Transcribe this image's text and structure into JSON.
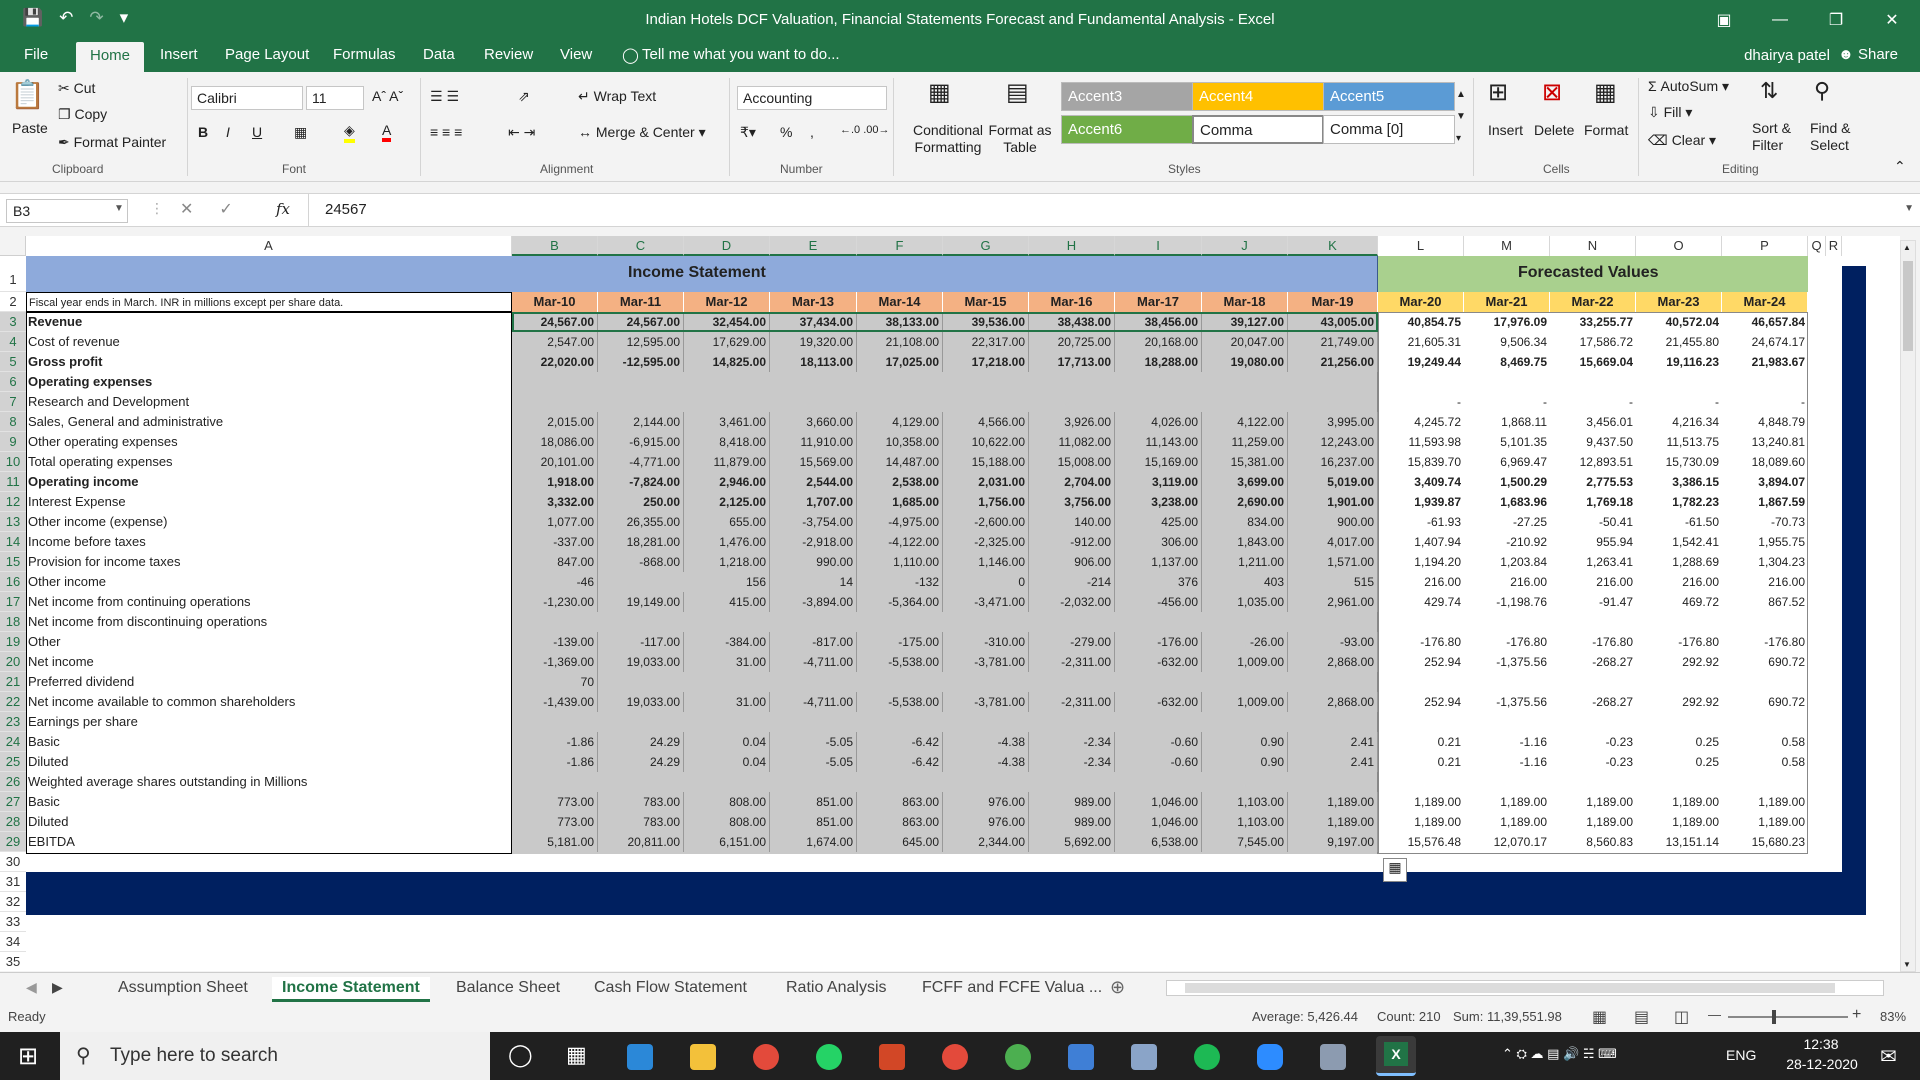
{
  "window": {
    "title": "Indian Hotels DCF Valuation, Financial Statements Forecast and Fundamental Analysis - Excel",
    "qat": [
      "save-icon",
      "undo-icon",
      "redo-icon",
      "customize-icon"
    ],
    "controls": [
      "ribbon-display-icon",
      "minimize-icon",
      "restore-icon",
      "close-icon"
    ]
  },
  "ribbon_tabs": [
    "File",
    "Home",
    "Insert",
    "Page Layout",
    "Formulas",
    "Data",
    "Review",
    "View"
  ],
  "active_tab": "Home",
  "tell_me": "Tell me what you want to do...",
  "user": "dhairya patel",
  "share": "Share",
  "clipboard": {
    "paste": "Paste",
    "cut": "Cut",
    "copy": "Copy",
    "format_painter": "Format Painter",
    "group": "Clipboard"
  },
  "font": {
    "name": "Calibri",
    "size": "11",
    "bold": "B",
    "italic": "I",
    "underline": "U",
    "group": "Font"
  },
  "alignment": {
    "wrap": "Wrap Text",
    "merge": "Merge & Center",
    "group": "Alignment"
  },
  "number": {
    "format": "Accounting",
    "percent": "%",
    "comma": ",",
    "group": "Number"
  },
  "styles": {
    "conditional": "Conditional Formatting",
    "format_as_table": "Format as Table",
    "cells": [
      {
        "label": "Accent3",
        "bg": "#a5a5a5",
        "fg": "#ffffff"
      },
      {
        "label": "Accent4",
        "bg": "#ffc000",
        "fg": "#ffffff"
      },
      {
        "label": "Accent5",
        "bg": "#5b9bd5",
        "fg": "#ffffff"
      },
      {
        "label": "Accent6",
        "bg": "#70ad47",
        "fg": "#ffffff"
      },
      {
        "label": "Comma",
        "bg": "#ffffff",
        "fg": "#000000"
      },
      {
        "label": "Comma [0]",
        "bg": "#ffffff",
        "fg": "#000000"
      }
    ],
    "group": "Styles"
  },
  "cells_grp": {
    "insert": "Insert",
    "delete": "Delete",
    "format": "Format",
    "group": "Cells"
  },
  "editing": {
    "autosum": "AutoSum",
    "fill": "Fill",
    "clear": "Clear",
    "sort": "Sort & Filter",
    "find": "Find & Select",
    "group": "Editing"
  },
  "formula_bar": {
    "name_box": "B3",
    "fx": "fx",
    "value": "24567"
  },
  "columns": [
    "A",
    "B",
    "C",
    "D",
    "E",
    "F",
    "G",
    "H",
    "I",
    "J",
    "K",
    "L",
    "M",
    "N",
    "O",
    "P",
    "Q",
    "R"
  ],
  "band": {
    "income": "Income Statement",
    "forecast": "Forecasted Values"
  },
  "row2_label": "Fiscal year ends in March. INR in millions except per share data.",
  "years": [
    "Mar-10",
    "Mar-11",
    "Mar-12",
    "Mar-13",
    "Mar-14",
    "Mar-15",
    "Mar-16",
    "Mar-17",
    "Mar-18",
    "Mar-19",
    "Mar-20",
    "Mar-21",
    "Mar-22",
    "Mar-23",
    "Mar-24"
  ],
  "rows": [
    {
      "r": 3,
      "label": "Revenue",
      "bold": true,
      "vals": [
        "24,567.00",
        "24,567.00",
        "32,454.00",
        "37,434.00",
        "38,133.00",
        "39,536.00",
        "38,438.00",
        "38,456.00",
        "39,127.00",
        "43,005.00",
        "40,854.75",
        "17,976.09",
        "33,255.77",
        "40,572.04",
        "46,657.84"
      ]
    },
    {
      "r": 4,
      "label": "Cost of revenue",
      "vals": [
        "2,547.00",
        "12,595.00",
        "17,629.00",
        "19,320.00",
        "21,108.00",
        "22,317.00",
        "20,725.00",
        "20,168.00",
        "20,047.00",
        "21,749.00",
        "21,605.31",
        "9,506.34",
        "17,586.72",
        "21,455.80",
        "24,674.17"
      ]
    },
    {
      "r": 5,
      "label": "Gross profit",
      "bold": true,
      "vals": [
        "22,020.00",
        "-12,595.00",
        "14,825.00",
        "18,113.00",
        "17,025.00",
        "17,218.00",
        "17,713.00",
        "18,288.00",
        "19,080.00",
        "21,256.00",
        "19,249.44",
        "8,469.75",
        "15,669.04",
        "19,116.23",
        "21,983.67"
      ]
    },
    {
      "r": 6,
      "label": "Operating expenses",
      "bold": true,
      "vals": []
    },
    {
      "r": 7,
      "label": "Research and Development",
      "vals": [
        "",
        "",
        "",
        "",
        "",
        "",
        "",
        "",
        "",
        "",
        "-",
        "-",
        "-",
        "-",
        "-"
      ]
    },
    {
      "r": 8,
      "label": "Sales, General and administrative",
      "vals": [
        "2,015.00",
        "2,144.00",
        "3,461.00",
        "3,660.00",
        "4,129.00",
        "4,566.00",
        "3,926.00",
        "4,026.00",
        "4,122.00",
        "3,995.00",
        "4,245.72",
        "1,868.11",
        "3,456.01",
        "4,216.34",
        "4,848.79"
      ]
    },
    {
      "r": 9,
      "label": "Other operating expenses",
      "vals": [
        "18,086.00",
        "-6,915.00",
        "8,418.00",
        "11,910.00",
        "10,358.00",
        "10,622.00",
        "11,082.00",
        "11,143.00",
        "11,259.00",
        "12,243.00",
        "11,593.98",
        "5,101.35",
        "9,437.50",
        "11,513.75",
        "13,240.81"
      ]
    },
    {
      "r": 10,
      "label": "Total operating expenses",
      "vals": [
        "20,101.00",
        "-4,771.00",
        "11,879.00",
        "15,569.00",
        "14,487.00",
        "15,188.00",
        "15,008.00",
        "15,169.00",
        "15,381.00",
        "16,237.00",
        "15,839.70",
        "6,969.47",
        "12,893.51",
        "15,730.09",
        "18,089.60"
      ]
    },
    {
      "r": 11,
      "label": "Operating income",
      "bold": true,
      "vals": [
        "1,918.00",
        "-7,824.00",
        "2,946.00",
        "2,544.00",
        "2,538.00",
        "2,031.00",
        "2,704.00",
        "3,119.00",
        "3,699.00",
        "5,019.00",
        "3,409.74",
        "1,500.29",
        "2,775.53",
        "3,386.15",
        "3,894.07"
      ]
    },
    {
      "r": 12,
      "label": "Interest Expense",
      "vals": [
        "3,332.00",
        "250.00",
        "2,125.00",
        "1,707.00",
        "1,685.00",
        "1,756.00",
        "3,756.00",
        "3,238.00",
        "2,690.00",
        "1,901.00",
        "1,939.87",
        "1,683.96",
        "1,769.18",
        "1,782.23",
        "1,867.59"
      ],
      "boldvals": true
    },
    {
      "r": 13,
      "label": "Other income (expense)",
      "vals": [
        "1,077.00",
        "26,355.00",
        "655.00",
        "-3,754.00",
        "-4,975.00",
        "-2,600.00",
        "140.00",
        "425.00",
        "834.00",
        "900.00",
        "-61.93",
        "-27.25",
        "-50.41",
        "-61.50",
        "-70.73"
      ]
    },
    {
      "r": 14,
      "label": "Income before taxes",
      "vals": [
        "-337.00",
        "18,281.00",
        "1,476.00",
        "-2,918.00",
        "-4,122.00",
        "-2,325.00",
        "-912.00",
        "306.00",
        "1,843.00",
        "4,017.00",
        "1,407.94",
        "-210.92",
        "955.94",
        "1,542.41",
        "1,955.75"
      ]
    },
    {
      "r": 15,
      "label": "Provision for income taxes",
      "vals": [
        "847.00",
        "-868.00",
        "1,218.00",
        "990.00",
        "1,110.00",
        "1,146.00",
        "906.00",
        "1,137.00",
        "1,211.00",
        "1,571.00",
        "1,194.20",
        "1,203.84",
        "1,263.41",
        "1,288.69",
        "1,304.23"
      ]
    },
    {
      "r": 16,
      "label": "Other income",
      "vals": [
        "-46",
        "",
        "156",
        "14",
        "-132",
        "0",
        "-214",
        "376",
        "403",
        "515",
        "216.00",
        "216.00",
        "216.00",
        "216.00",
        "216.00"
      ]
    },
    {
      "r": 17,
      "label": "Net income from continuing operations",
      "vals": [
        "-1,230.00",
        "19,149.00",
        "415.00",
        "-3,894.00",
        "-5,364.00",
        "-3,471.00",
        "-2,032.00",
        "-456.00",
        "1,035.00",
        "2,961.00",
        "429.74",
        "-1,198.76",
        "-91.47",
        "469.72",
        "867.52"
      ]
    },
    {
      "r": 18,
      "label": "Net income from discontinuing operations",
      "vals": []
    },
    {
      "r": 19,
      "label": "Other",
      "vals": [
        "-139.00",
        "-117.00",
        "-384.00",
        "-817.00",
        "-175.00",
        "-310.00",
        "-279.00",
        "-176.00",
        "-26.00",
        "-93.00",
        "-176.80",
        "-176.80",
        "-176.80",
        "-176.80",
        "-176.80"
      ]
    },
    {
      "r": 20,
      "label": "Net income",
      "vals": [
        "-1,369.00",
        "19,033.00",
        "31.00",
        "-4,711.00",
        "-5,538.00",
        "-3,781.00",
        "-2,311.00",
        "-632.00",
        "1,009.00",
        "2,868.00",
        "252.94",
        "-1,375.56",
        "-268.27",
        "292.92",
        "690.72"
      ]
    },
    {
      "r": 21,
      "label": "Preferred dividend",
      "vals": [
        "70"
      ]
    },
    {
      "r": 22,
      "label": "Net income available to common shareholders",
      "vals": [
        "-1,439.00",
        "19,033.00",
        "31.00",
        "-4,711.00",
        "-5,538.00",
        "-3,781.00",
        "-2,311.00",
        "-632.00",
        "1,009.00",
        "2,868.00",
        "252.94",
        "-1,375.56",
        "-268.27",
        "292.92",
        "690.72"
      ]
    },
    {
      "r": 23,
      "label": "Earnings per share",
      "vals": []
    },
    {
      "r": 24,
      "label": "Basic",
      "vals": [
        "-1.86",
        "24.29",
        "0.04",
        "-5.05",
        "-6.42",
        "-4.38",
        "-2.34",
        "-0.60",
        "0.90",
        "2.41",
        "0.21",
        "-1.16",
        "-0.23",
        "0.25",
        "0.58"
      ]
    },
    {
      "r": 25,
      "label": "Diluted",
      "vals": [
        "-1.86",
        "24.29",
        "0.04",
        "-5.05",
        "-6.42",
        "-4.38",
        "-2.34",
        "-0.60",
        "0.90",
        "2.41",
        "0.21",
        "-1.16",
        "-0.23",
        "0.25",
        "0.58"
      ]
    },
    {
      "r": 26,
      "label": "Weighted average shares outstanding in Millions",
      "vals": []
    },
    {
      "r": 27,
      "label": "Basic",
      "vals": [
        "773.00",
        "783.00",
        "808.00",
        "851.00",
        "863.00",
        "976.00",
        "989.00",
        "1,046.00",
        "1,103.00",
        "1,189.00",
        "1,189.00",
        "1,189.00",
        "1,189.00",
        "1,189.00",
        "1,189.00"
      ]
    },
    {
      "r": 28,
      "label": "Diluted",
      "vals": [
        "773.00",
        "783.00",
        "808.00",
        "851.00",
        "863.00",
        "976.00",
        "989.00",
        "1,046.00",
        "1,103.00",
        "1,189.00",
        "1,189.00",
        "1,189.00",
        "1,189.00",
        "1,189.00",
        "1,189.00"
      ]
    },
    {
      "r": 29,
      "label": "EBITDA",
      "vals": [
        "5,181.00",
        "20,811.00",
        "6,151.00",
        "1,674.00",
        "645.00",
        "2,344.00",
        "5,692.00",
        "6,538.00",
        "7,545.00",
        "9,197.00",
        "15,576.48",
        "12,070.17",
        "8,560.83",
        "13,151.14",
        "15,680.23"
      ]
    }
  ],
  "sheets": [
    "Assumption Sheet",
    "Income Statement",
    "Balance Sheet",
    "Cash Flow Statement",
    "Ratio Analysis",
    "FCFF and FCFE Valua ..."
  ],
  "active_sheet": "Income Statement",
  "status": {
    "ready": "Ready",
    "average": "Average:  5,426.44",
    "count": "Count: 210",
    "sum": "Sum:  11,39,551.98",
    "zoom": "83%"
  },
  "taskbar": {
    "search": "Type here to search",
    "lang": "ENG",
    "time": "12:38",
    "date": "28-12-2020"
  }
}
